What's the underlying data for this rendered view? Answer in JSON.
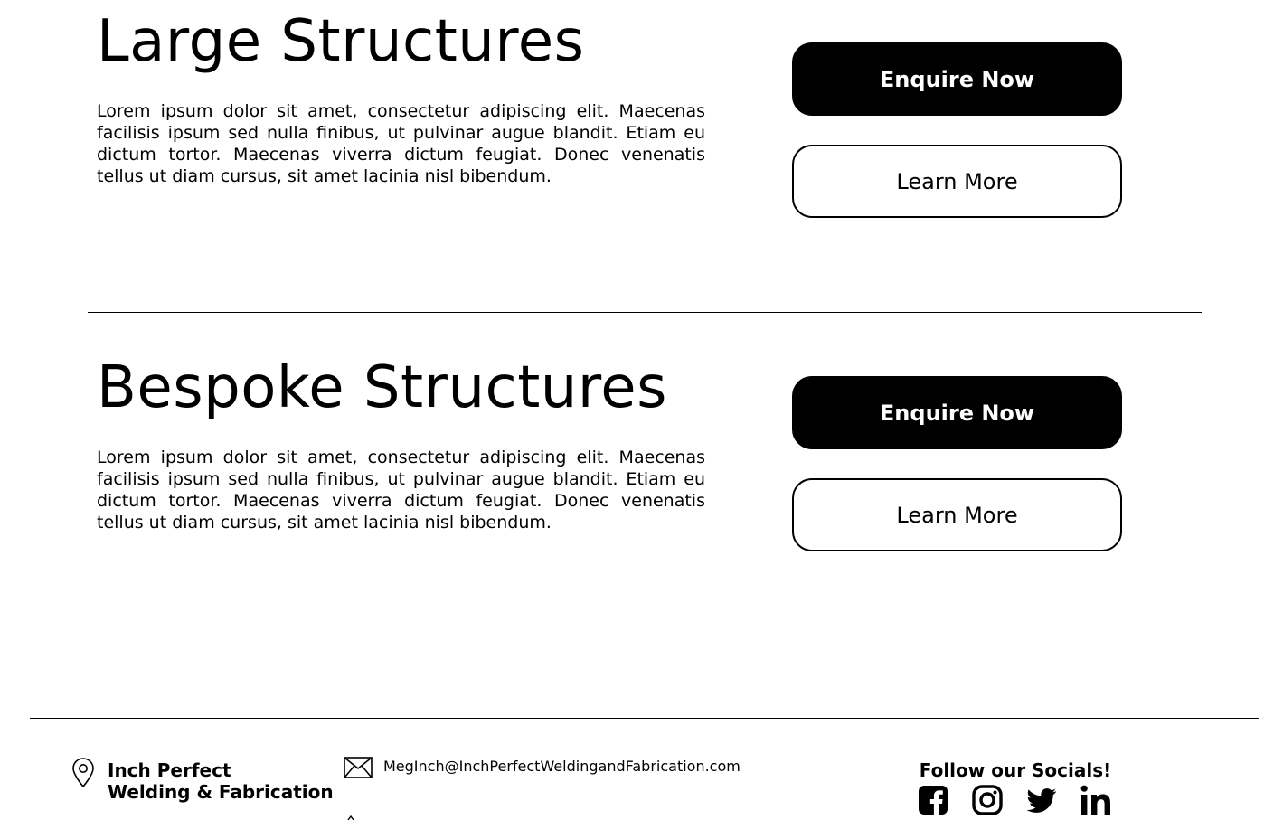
{
  "sections": [
    {
      "title": "Large Structures",
      "body": "Lorem ipsum dolor sit amet, consectetur adipiscing elit. Maecenas facilisis ipsum sed nulla finibus, ut pulvinar augue blandit. Etiam eu dictum tortor. Maecenas viverra dictum feugiat. Donec venenatis tellus ut diam cursus, sit amet lacinia nisl bibendum.",
      "enquire_label": "Enquire Now",
      "learn_label": "Learn More"
    },
    {
      "title": "Bespoke Structures",
      "body": "Lorem ipsum dolor sit amet, consectetur adipiscing elit. Maecenas facilisis ipsum sed nulla finibus, ut pulvinar augue blandit. Etiam eu dictum tortor. Maecenas viverra dictum feugiat. Donec venenatis tellus ut diam cursus, sit amet lacinia nisl bibendum.",
      "enquire_label": "Enquire Now",
      "learn_label": "Learn More"
    }
  ],
  "footer": {
    "brand_line1": "Inch Perfect",
    "brand_line2": "Welding & Fabrication",
    "email": "MegInch@InchPerfectWeldingandFabrication.com",
    "socials_heading": "Follow our Socials!",
    "location_icon": "map-pin-icon",
    "email_icon": "envelope-icon",
    "social_icons": [
      "facebook-icon",
      "instagram-icon",
      "twitter-icon",
      "linkedin-icon"
    ]
  },
  "colors": {
    "background": "#ffffff",
    "text": "#000000",
    "primary_button": "#000000",
    "primary_button_text": "#ffffff"
  }
}
